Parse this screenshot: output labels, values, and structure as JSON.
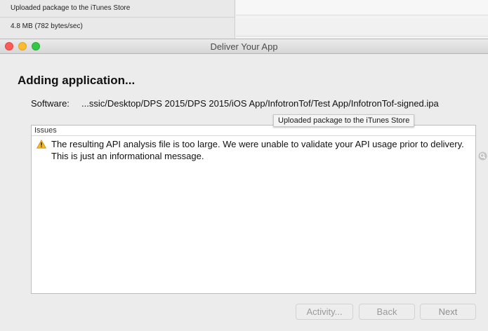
{
  "background_window": {
    "upload_status": "Uploaded package to the iTunes Store",
    "upload_rate": "4.8 MB (782 bytes/sec)"
  },
  "window": {
    "title": "Deliver Your App"
  },
  "main": {
    "heading": "Adding application...",
    "software_label": "Software:",
    "software_path": "...ssic/Desktop/DPS 2015/DPS 2015/iOS App/InfotronTof/Test App/InfotronTof-signed.ipa"
  },
  "issues": {
    "header": "Issues",
    "items": [
      {
        "icon": "warning-icon",
        "text": "The resulting API analysis file is too large.  We were unable to validate your API usage prior to delivery.  This is just an informational message."
      }
    ]
  },
  "tooltip": {
    "text": "Uploaded package to the iTunes Store"
  },
  "buttons": {
    "activity": "Activity...",
    "back": "Back",
    "next": "Next"
  },
  "colors": {
    "close": "#fc5b57",
    "minimize": "#fdbc2e",
    "maximize": "#33c748",
    "warning": "#f5b82e"
  }
}
